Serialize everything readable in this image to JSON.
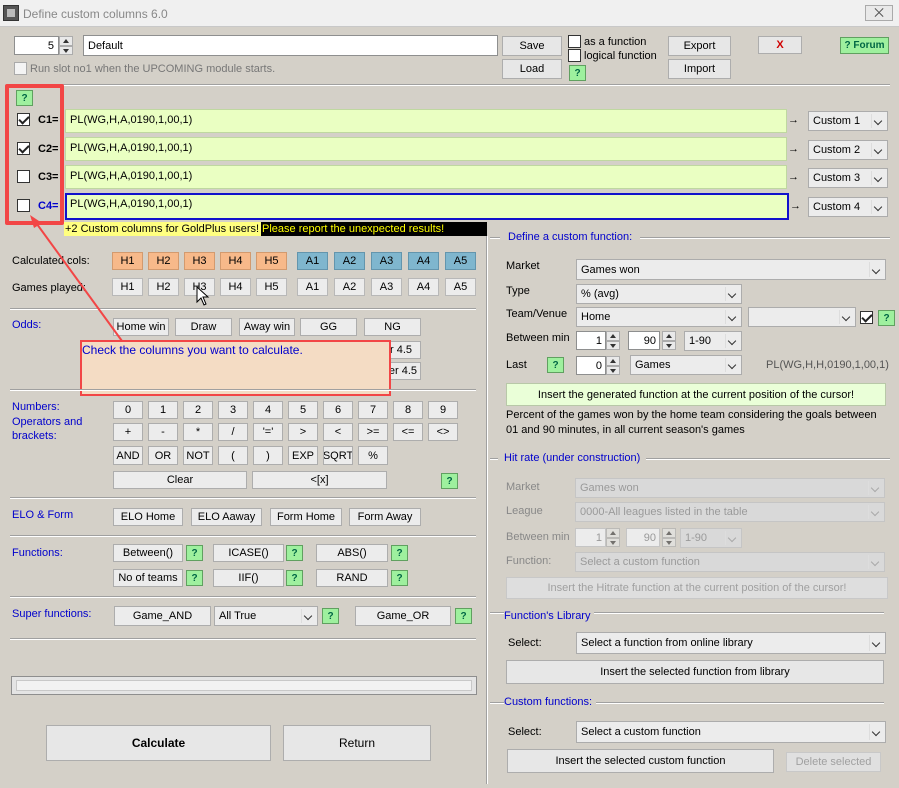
{
  "window": {
    "title": "Define custom columns 6.0",
    "close_glyph": "⨉"
  },
  "top": {
    "slot_value": "5",
    "name_value": "Default",
    "save_label": "Save",
    "load_label": "Load",
    "as_function_label": "as a function",
    "logical_function_label": "logical function",
    "help_label": "?",
    "export_label": "Export",
    "import_label": "Import",
    "x_label": "X",
    "forum_label": "? Forum",
    "run_slot_label": "Run slot no1 when the UPCOMING module starts."
  },
  "columns": [
    {
      "label": "C1=",
      "checked": true,
      "formula": "PL(WG,H,A,0190,1,00,1)",
      "target": "Custom 1"
    },
    {
      "label": "C2=",
      "checked": true,
      "formula": "PL(WG,H,A,0190,1,00,1)",
      "target": "Custom 2"
    },
    {
      "label": "C3=",
      "checked": false,
      "formula": "PL(WG,H,A,0190,1,00,1)",
      "target": "Custom 3"
    },
    {
      "label": "C4=",
      "checked": false,
      "formula": "PL(WG,H,A,0190,1,00,1)",
      "target": "Custom 4"
    }
  ],
  "notices": {
    "goldplus": "+2 Custom columns for GoldPlus users!",
    "report": "Please report the unexpected results!"
  },
  "calc_cols": {
    "label": "Calculated cols:",
    "h": [
      "H1",
      "H2",
      "H3",
      "H4",
      "H5"
    ],
    "a": [
      "A1",
      "A2",
      "A3",
      "A4",
      "A5"
    ]
  },
  "games_played": {
    "label": "Games played:",
    "h": [
      "H1",
      "H2",
      "H3",
      "H4",
      "H5"
    ],
    "a": [
      "A1",
      "A2",
      "A3",
      "A4",
      "A5"
    ]
  },
  "odds": {
    "label": "Odds:",
    "buttons": [
      "Home win",
      "Draw",
      "Away win",
      "GG",
      "NG"
    ],
    "partial1": "r 4.5",
    "partial2": "er 4.5"
  },
  "tooltip": {
    "text": "Check the columns you want to calculate."
  },
  "numbers": {
    "label1": "Numbers:",
    "label2": "Operators and",
    "label3": "brackets:",
    "row1": [
      "0",
      "1",
      "2",
      "3",
      "4",
      "5",
      "6",
      "7",
      "8",
      "9"
    ],
    "row2": [
      "+",
      "-",
      "*",
      "/",
      "'='",
      ">",
      "<",
      ">=",
      "<=",
      "<>"
    ],
    "row3": [
      "AND",
      "OR",
      "NOT",
      "(",
      ")",
      "EXP",
      "SQRT",
      "%"
    ],
    "clear": "Clear",
    "back": "<[x]"
  },
  "elo": {
    "label": "ELO & Form",
    "buttons": [
      "ELO Home",
      "ELO Aaway",
      "Form Home",
      "Form Away"
    ]
  },
  "functions": {
    "label": "Functions:",
    "row1": [
      "Between()",
      "ICASE()",
      "ABS()"
    ],
    "row2": [
      "No of teams",
      "IIF()",
      "RAND"
    ]
  },
  "super": {
    "label": "Super functions:",
    "and": "Game_AND",
    "select": "All True",
    "or": "Game_OR"
  },
  "bottom": {
    "calculate": "Calculate",
    "return": "Return"
  },
  "define": {
    "title": "Define a custom function:",
    "market_label": "Market",
    "market_value": "Games won",
    "type_label": "Type",
    "type_value": "% (avg)",
    "team_label": "Team/Venue",
    "team_value": "Home",
    "between_label": "Between min",
    "min_from": "1",
    "min_to": "90",
    "range": "1-90",
    "last_label": "Last",
    "last_value": "0",
    "last_unit": "Games",
    "generated": "PL(WG,H,H,0190,1,00,1)",
    "insert_btn": "Insert the generated function at the current position of the cursor!",
    "description": "Percent of the games won by the home team considering the goals between 01 and 90 minutes, in all current season's games"
  },
  "hitrate": {
    "title": "Hit rate (under construction)",
    "market_label": "Market",
    "market_value": "Games won",
    "league_label": "League",
    "league_value": "0000-All leagues listed in the table",
    "between_label": "Between min",
    "min_from": "1",
    "min_to": "90",
    "range": "1-90",
    "function_label": "Function:",
    "function_value": "Select a custom function",
    "insert_btn": "Insert the Hitrate function at the current position of the cursor!"
  },
  "library": {
    "title": "Function's Library",
    "select_label": "Select:",
    "select_value": "Select a function from online library",
    "insert_btn": "Insert the selected function from library"
  },
  "custom": {
    "title": "Custom functions:",
    "select_label": "Select:",
    "select_value": "Select a custom function",
    "insert_btn": "Insert the selected custom function",
    "delete_btn": "Delete selected"
  }
}
